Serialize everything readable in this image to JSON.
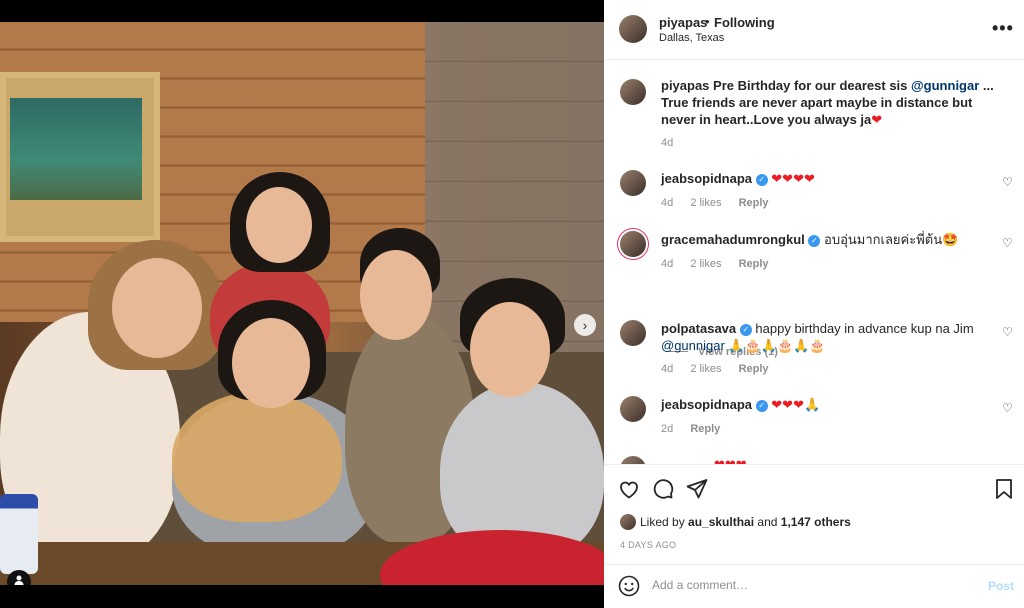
{
  "photo": {
    "carousel_dots": 10,
    "active_dot": 0,
    "next_icon": "chevron-right-icon",
    "tag_icon": "user-tag-icon"
  },
  "header": {
    "username": "piyapas",
    "separator": "•",
    "follow_label": "Following",
    "location": "Dallas, Texas",
    "more_icon": "more-options-icon"
  },
  "caption": {
    "username": "piyapas",
    "text_line1": "Pre Birthday for our dearest sis ",
    "mention": "@gunnigar",
    "ellipsis": " ...",
    "text_line2": "True friends are never apart maybe in distance but never in heart..Love you always ja",
    "heart": "❤",
    "time": "4d"
  },
  "comments": [
    {
      "username": "jeabsopidnapa",
      "verified": true,
      "text": "❤❤❤❤",
      "time": "4d",
      "likes": "2 likes",
      "reply": "Reply"
    },
    {
      "username": "gracemahadumrongkul",
      "verified": true,
      "text": "อบอุ่นมากเลยค่ะพี่ต้น🤩",
      "time": "4d",
      "likes": "2 likes",
      "reply": "Reply"
    },
    {
      "username": "polpatasava",
      "verified": true,
      "text": "happy birthday in advance kup na Jim",
      "mention": "@gunnigar",
      "emojis": "🙏🎂🙏🎂🙏🎂",
      "time": "4d",
      "likes": "2 likes",
      "reply": "Reply"
    },
    {
      "username": "jeabsopidnapa",
      "verified": true,
      "text": "❤❤❤🙏",
      "time": "2d",
      "reply": "Reply"
    }
  ],
  "view_replies": "View replies (1)",
  "partial_comment": "❤❤❤",
  "actions": {
    "like_icon": "heart-icon",
    "comment_icon": "comment-icon",
    "share_icon": "share-icon",
    "save_icon": "bookmark-icon"
  },
  "likes": {
    "prefix": "Liked by ",
    "user": "au_skulthai",
    "middle": " and ",
    "count": "1,147 others"
  },
  "posted": "4 DAYS AGO",
  "add_comment": {
    "placeholder": "Add a comment…",
    "post_label": "Post",
    "emoji_icon": "emoji-icon"
  }
}
